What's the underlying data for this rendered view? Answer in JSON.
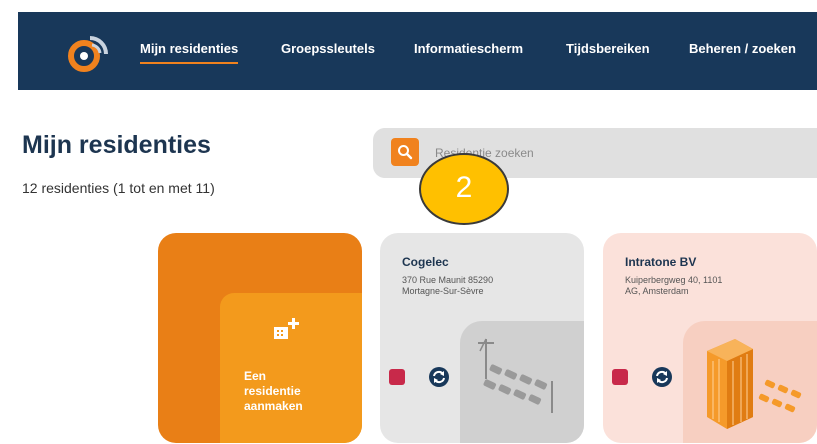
{
  "nav": {
    "items": [
      {
        "label": "Mijn residenties",
        "active": true
      },
      {
        "label": "Groepssleutels"
      },
      {
        "label": "Informatiescherm"
      },
      {
        "label": "Tijdsbereiken"
      },
      {
        "label": "Beheren / zoeken"
      }
    ]
  },
  "page": {
    "title": "Mijn residenties",
    "subtitle": "12 residenties (1 tot en met 11)"
  },
  "search": {
    "placeholder": "Residentie zoeken"
  },
  "callout": {
    "number": "2"
  },
  "cards": {
    "create_label_1": "Een",
    "create_label_2": "residentie",
    "create_label_3": "aanmaken",
    "cogelec": {
      "name": "Cogelec",
      "address_line1": "370 Rue Maunit 85290",
      "address_line2": "Mortagne-Sur-Sèvre"
    },
    "intratone": {
      "name": "Intratone BV",
      "address_line1": "Kuiperbergweg 40, 1101",
      "address_line2": "AG, Amsterdam"
    }
  },
  "colors": {
    "nav_bg": "#18385a",
    "accent": "#f0821e",
    "status_red": "#c8294a"
  },
  "icons": [
    "logo-icon",
    "search-icon",
    "building-add-icon",
    "sync-icon"
  ]
}
